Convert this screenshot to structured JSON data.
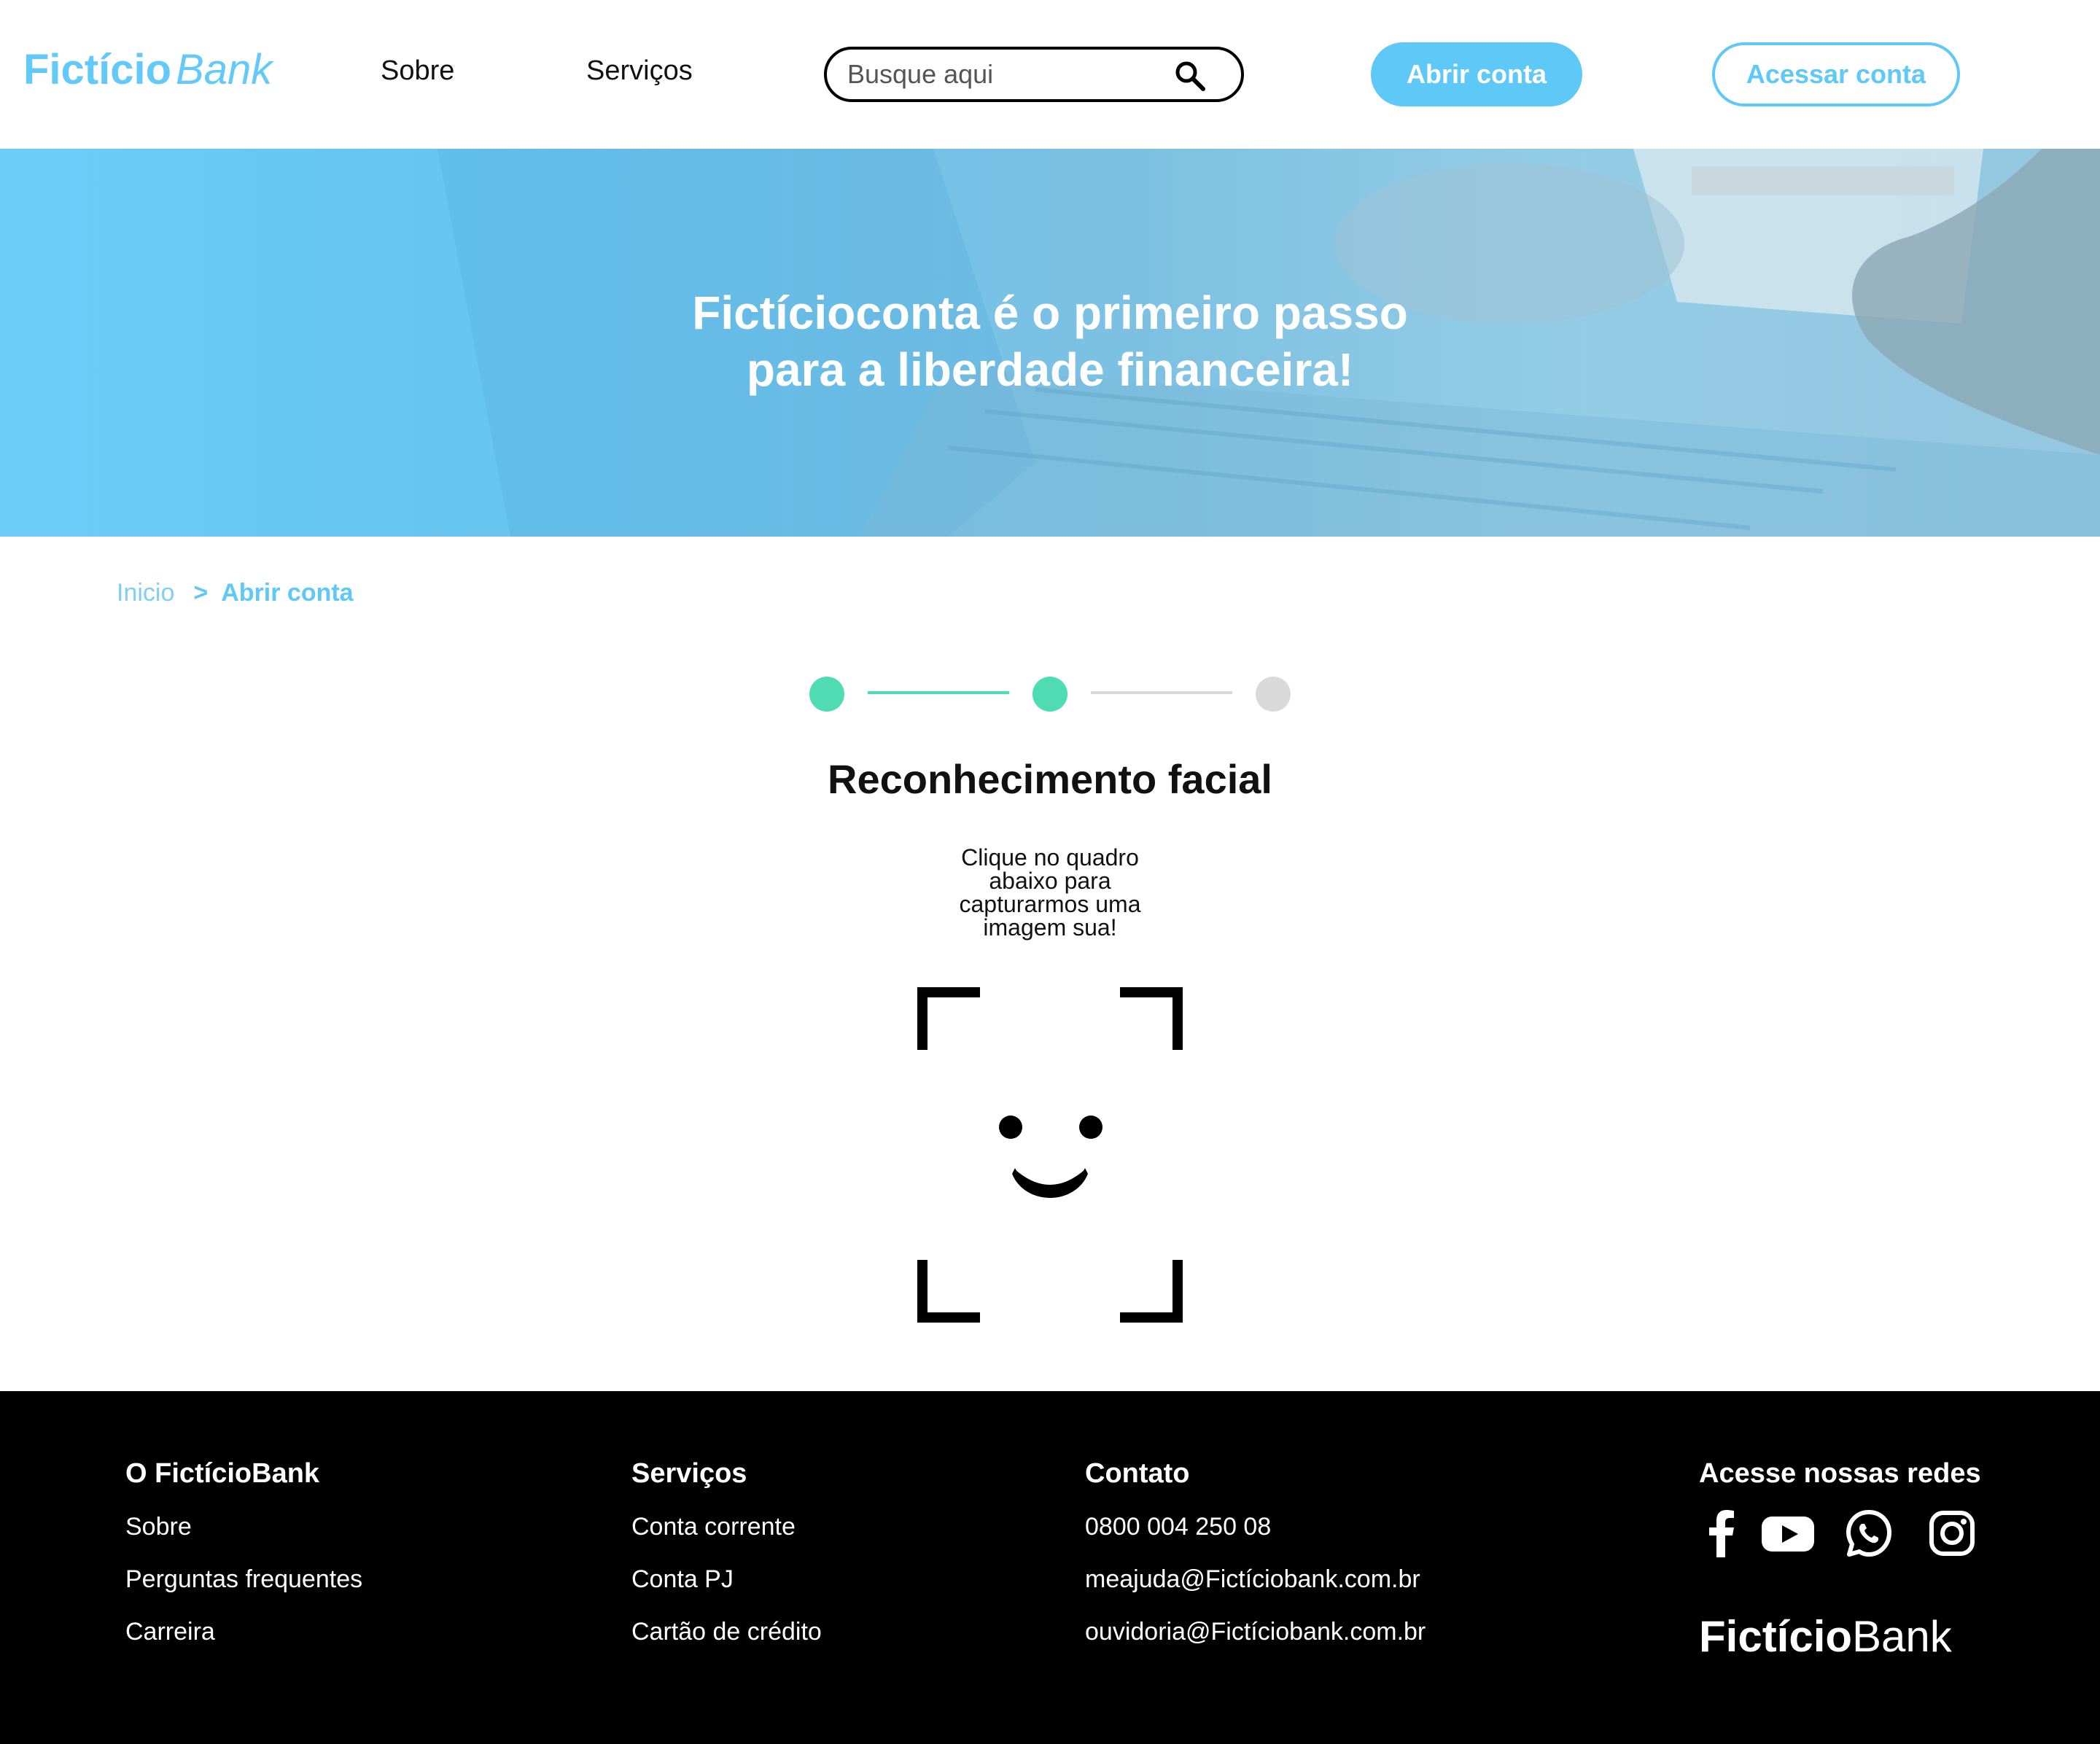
{
  "header": {
    "logo": {
      "strong": "Fictício",
      "light": "Bank"
    },
    "nav": [
      "Sobre",
      "Serviços"
    ],
    "search": {
      "placeholder": "Busque aqui",
      "value": ""
    },
    "primary_button": "Abrir conta",
    "outline_button": "Acessar conta"
  },
  "hero": {
    "title_line1": "Fictícioconta é o primeiro passo",
    "title_line2": "para a liberdade financeira!"
  },
  "breadcrumb": {
    "home": "Inicio",
    "separator": ">",
    "current": "Abrir conta"
  },
  "stepper": {
    "steps_total": 3,
    "current_step": 2,
    "colors": {
      "done": "#4fdcb2",
      "pending": "#d9d9d9"
    },
    "title": "Reconhecimento facial",
    "description_lines": [
      "Clique no quadro",
      "abaixo para",
      "capturarmos uma",
      "imagem sua!"
    ]
  },
  "colors": {
    "brand": "#5ec8f7",
    "footer_bg": "#000000"
  },
  "footer": {
    "col1": {
      "title": "O FictícioBank",
      "links": [
        "Sobre",
        "Perguntas frequentes",
        "Carreira"
      ]
    },
    "col2": {
      "title": "Serviços",
      "links": [
        "Conta corrente",
        "Conta PJ",
        "Cartão de crédito"
      ]
    },
    "col3": {
      "title": "Contato",
      "links": [
        "0800 004 250 08",
        "meajuda@Fictíciobank.com.br",
        "ouvidoria@Fictíciobank.com.br"
      ]
    },
    "social": {
      "title": "Acesse nossas redes",
      "icons": [
        "facebook-icon",
        "youtube-icon",
        "whatsapp-icon",
        "instagram-icon"
      ]
    },
    "logo": {
      "strong": "Fictício",
      "light": "Bank"
    }
  }
}
